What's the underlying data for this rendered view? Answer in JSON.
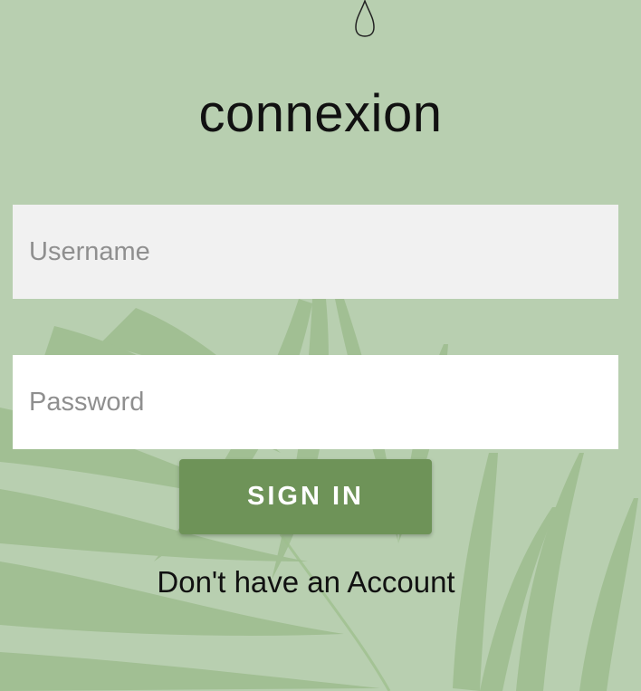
{
  "login": {
    "title": "connexion",
    "username_placeholder": "Username",
    "username_value": "",
    "password_placeholder": "Password",
    "password_value": "",
    "sign_in_label": "SIGN IN",
    "signup_link_label": "Don't have an Account"
  },
  "icons": {
    "top": "drop-icon",
    "background": "palm-leaf-icon"
  },
  "colors": {
    "background": "#b8cfb0",
    "button": "#6e9358",
    "username_field": "#f1f1f1",
    "password_field": "#ffffff"
  }
}
